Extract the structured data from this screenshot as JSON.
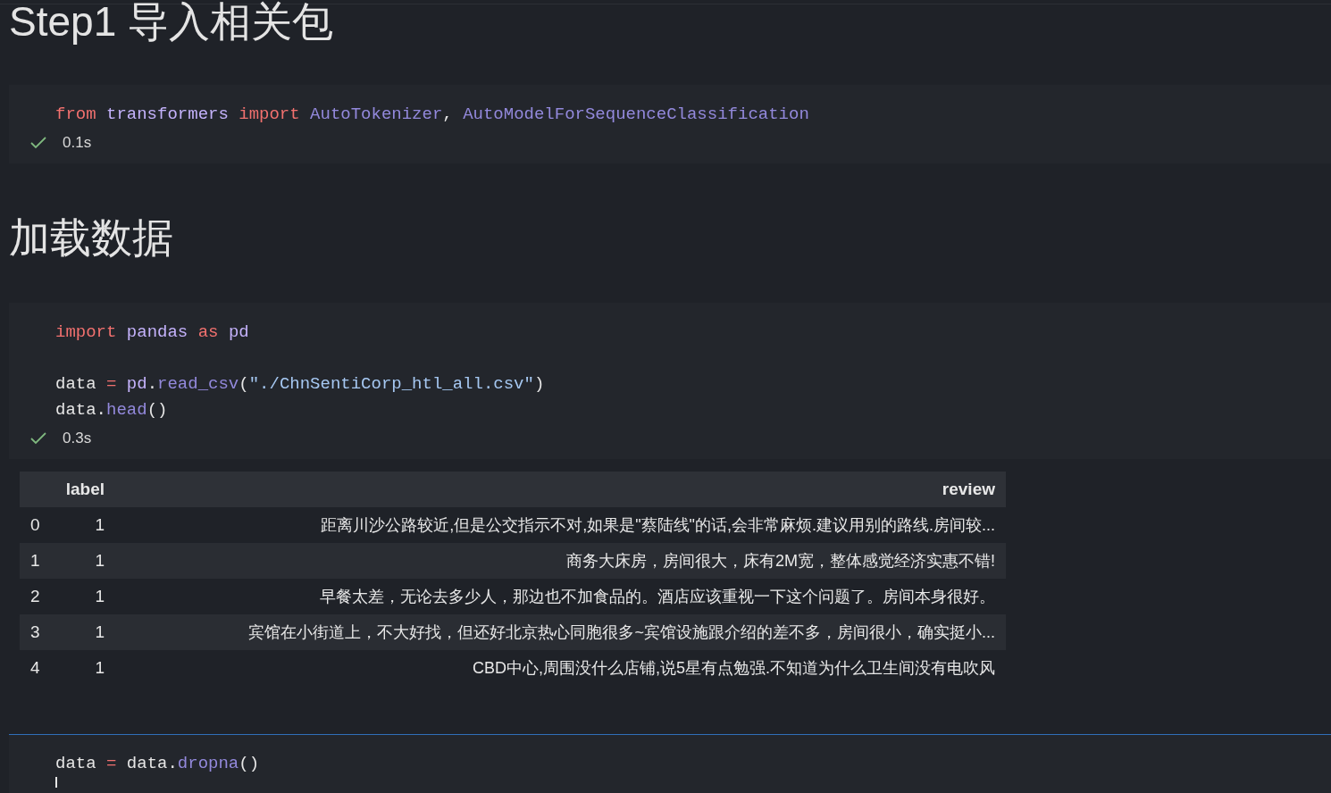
{
  "cells": [
    {
      "kind": "markdown",
      "text": "Step1 导入相关包"
    },
    {
      "kind": "code",
      "focused": false,
      "lines": [
        {
          "tokens": [
            {
              "text": "from ",
              "kind": "keyword"
            },
            {
              "text": "transformers ",
              "kind": "module"
            },
            {
              "text": "import ",
              "kind": "keyword"
            },
            {
              "text": "AutoTokenizer",
              "kind": "name"
            },
            {
              "text": ", ",
              "kind": "plain"
            },
            {
              "text": "AutoModelForSequenceClassification",
              "kind": "name"
            }
          ]
        }
      ],
      "status": {
        "succeeded": true,
        "time": "0.1s"
      }
    },
    {
      "kind": "markdown",
      "text": "加载数据"
    },
    {
      "kind": "code",
      "focused": false,
      "lines": [
        {
          "tokens": [
            {
              "text": "import ",
              "kind": "keyword"
            },
            {
              "text": "pandas ",
              "kind": "module"
            },
            {
              "text": "as ",
              "kind": "keyword"
            },
            {
              "text": "pd",
              "kind": "module"
            }
          ]
        },
        {
          "gap_before": true,
          "tokens": [
            {
              "text": "data ",
              "kind": "plain"
            },
            {
              "text": "= ",
              "kind": "operator"
            },
            {
              "text": "pd",
              "kind": "module"
            },
            {
              "text": ".",
              "kind": "plain"
            },
            {
              "text": "read_csv",
              "kind": "name"
            },
            {
              "text": "(",
              "kind": "plain"
            },
            {
              "text": "\"./ChnSentiCorp_htl_all.csv\"",
              "kind": "string"
            },
            {
              "text": ")",
              "kind": "plain"
            }
          ]
        },
        {
          "tokens": [
            {
              "text": "data",
              "kind": "plain"
            },
            {
              "text": ".",
              "kind": "plain"
            },
            {
              "text": "head",
              "kind": "name"
            },
            {
              "text": "()",
              "kind": "plain"
            }
          ]
        }
      ],
      "status": {
        "succeeded": true,
        "time": "0.3s"
      },
      "output": {
        "columns": [
          "label",
          "review"
        ],
        "rows": [
          {
            "index": "0",
            "label": "1",
            "review": "距离川沙公路较近,但是公交指示不对,如果是\"蔡陆线\"的话,会非常麻烦.建议用别的路线.房间较..."
          },
          {
            "index": "1",
            "label": "1",
            "review": "商务大床房，房间很大，床有2M宽，整体感觉经济实惠不错!"
          },
          {
            "index": "2",
            "label": "1",
            "review": "早餐太差，无论去多少人，那边也不加食品的。酒店应该重视一下这个问题了。房间本身很好。"
          },
          {
            "index": "3",
            "label": "1",
            "review": "宾馆在小街道上，不大好找，但还好北京热心同胞很多~宾馆设施跟介绍的差不多，房间很小，确实挺小..."
          },
          {
            "index": "4",
            "label": "1",
            "review": "CBD中心,周围没什么店铺,说5星有点勉强.不知道为什么卫生间没有电吹风"
          }
        ]
      }
    },
    {
      "kind": "code",
      "focused": true,
      "lines": [
        {
          "tokens": [
            {
              "text": "data ",
              "kind": "plain"
            },
            {
              "text": "= ",
              "kind": "operator"
            },
            {
              "text": "data",
              "kind": "plain"
            },
            {
              "text": ".",
              "kind": "plain"
            },
            {
              "text": "dropna",
              "kind": "name"
            },
            {
              "text": "()",
              "kind": "plain"
            }
          ]
        }
      ]
    }
  ]
}
